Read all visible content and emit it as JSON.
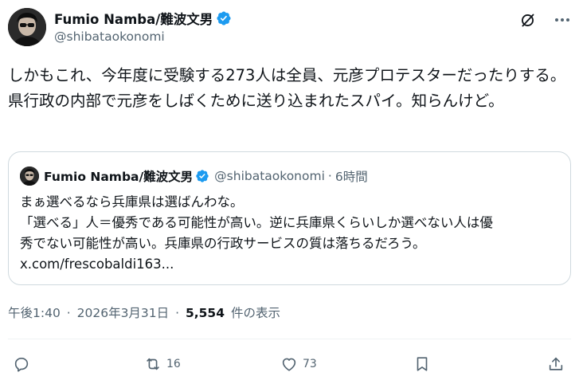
{
  "author": {
    "display_name": "Fumio Namba/難波文男",
    "handle": "@shibataokonomi"
  },
  "header": {
    "grok_icon": "grok-slash-icon",
    "more_icon": "more-dots-icon"
  },
  "post": {
    "text": "しかもこれ、今年度に受験する273人は全員、元彦プロテスターだったりする。県行政の内部で元彦をしばくために送り込まれたスパイ。知らんけど。"
  },
  "quote": {
    "display_name": "Fumio Namba/難波文男",
    "handle": "@shibataokonomi",
    "separator": "·",
    "time": "6時間",
    "lines": [
      "まぁ選べるなら兵庫県は選ばんわな。",
      "「選べる」人＝優秀である可能性が高い。逆に兵庫県くらいしか選べない人は優",
      "秀でない可能性が高い。兵庫県の行政サービスの質は落ちるだろう。",
      "x.com/frescobaldi163..."
    ]
  },
  "meta": {
    "time": "午後1:40",
    "sep1": "·",
    "date": "2026年3月31日",
    "sep2": "·",
    "views": "5,554",
    "views_label": "件の表示"
  },
  "actions": {
    "reply": {
      "icon": "reply-icon",
      "count": ""
    },
    "repost": {
      "icon": "repost-icon",
      "count": "16"
    },
    "like": {
      "icon": "heart-icon",
      "count": "73"
    },
    "bookmark": {
      "icon": "bookmark-icon",
      "count": ""
    },
    "share": {
      "icon": "share-icon",
      "count": ""
    }
  },
  "colors": {
    "verified": "#1d9bf0",
    "secondary_text": "#536471",
    "primary_text": "#0f1419",
    "border": "#cfd9de"
  }
}
